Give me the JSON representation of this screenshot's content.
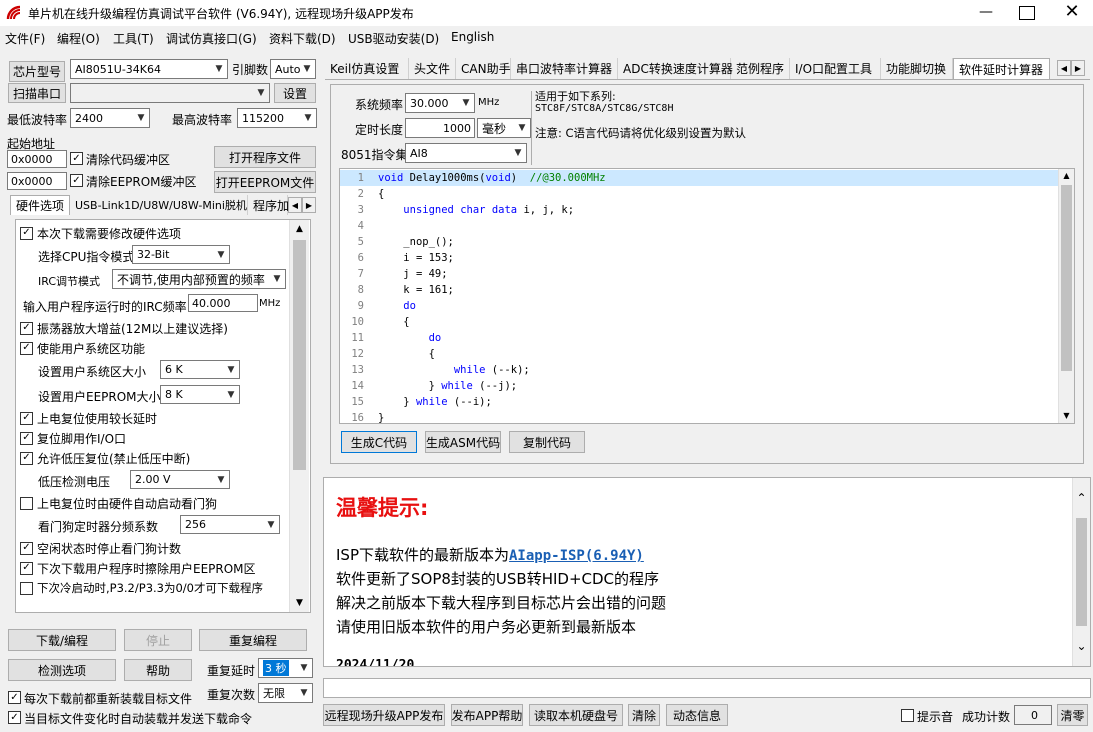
{
  "window": {
    "title": "单片机在线升级编程仿真调试平台软件 (V6.94Y), 远程现场升级APP发布"
  },
  "menu": [
    "文件(F)",
    "编程(O)",
    "工具(T)",
    "调试仿真接口(G)",
    "资料下载(D)",
    "USB驱动安装(D)",
    "English"
  ],
  "left": {
    "chip_label": "芯片型号",
    "chip_value": "AI8051U-34K64",
    "pins_label": "引脚数",
    "pins_value": "Auto",
    "scan_port": "扫描串口",
    "port_value": "",
    "settings": "设置",
    "min_baud_label": "最低波特率",
    "min_baud": "2400",
    "max_baud_label": "最高波特率",
    "max_baud": "115200",
    "start_addr_label": "起始地址",
    "addr1": "0x0000",
    "clear_code": "清除代码缓冲区",
    "open_prog": "打开程序文件",
    "addr2": "0x0000",
    "clear_eeprom": "清除EEPROM缓冲区",
    "open_eeprom": "打开EEPROM文件",
    "tabs": [
      "硬件选项",
      "USB-Link1D/U8W/U8W-Mini脱机",
      "程序加"
    ],
    "options": {
      "o1": "本次下载需要修改硬件选项",
      "cpu_label": "选择CPU指令模式",
      "cpu_value": "32-Bit",
      "irc_label": "IRC调节模式",
      "irc_value": "不调节,使用内部预置的频率",
      "freq_label": "输入用户程序运行时的IRC频率",
      "freq_value": "40.000",
      "freq_unit": "MHz",
      "o2": "振荡器放大增益(12M以上建议选择)",
      "o3": "使能用户系统区功能",
      "sys_size_label": "设置用户系统区大小",
      "sys_size": "6   K",
      "eeprom_size_label": "设置用户EEPROM大小",
      "eeprom_size": "8   K",
      "o4": "上电复位使用较长延时",
      "o5": "复位脚用作I/O口",
      "o6": "允许低压复位(禁止低压中断)",
      "lv_label": "低压检测电压",
      "lv_value": "2.00 V",
      "o7": "上电复位时由硬件自动启动看门狗",
      "wdt_label": "看门狗定时器分频系数",
      "wdt_value": "256",
      "o8": "空闲状态时停止看门狗计数",
      "o9": "下次下载用户程序时擦除用户EEPROM区",
      "o10": "下次冷启动时,P3.2/P3.3为0/0才可下载程序"
    },
    "download": "下载/编程",
    "stop": "停止",
    "reprogram": "重复编程",
    "check": "检测选项",
    "help": "帮助",
    "repeat_delay_label": "重复延时",
    "repeat_delay": "3 秒",
    "repeat_count_label": "重复次数",
    "repeat_count": "无限",
    "reload1": "每次下载前都重新装载目标文件",
    "reload2": "当目标文件变化时自动装载并发送下载命令"
  },
  "right": {
    "tabs": [
      "Keil仿真设置",
      "头文件",
      "CAN助手",
      "串口波特率计算器",
      "ADC转换速度计算器",
      "范例程序",
      "I/O口配置工具",
      "功能脚切换",
      "软件延时计算器"
    ],
    "freq_label": "系统频率",
    "freq_value": "30.000",
    "freq_unit": "MHz",
    "len_label": "定时长度",
    "len_value": "1000",
    "len_unit": "毫秒",
    "isa_label": "8051指令集",
    "isa_value": "AI8",
    "applies": "适用于如下系列:",
    "series": "STC8F/STC8A/STC8G/STC8H",
    "note": "注意: C语言代码请将优化级别设置为默认",
    "code_lines": [
      {
        "n": "1",
        "t": "void Delay1000ms(void)  //@30.000MHz"
      },
      {
        "n": "2",
        "t": "{"
      },
      {
        "n": "3",
        "t": "    unsigned char data i, j, k;"
      },
      {
        "n": "4",
        "t": ""
      },
      {
        "n": "5",
        "t": "    _nop_();"
      },
      {
        "n": "6",
        "t": "    i = 153;"
      },
      {
        "n": "7",
        "t": "    j = 49;"
      },
      {
        "n": "8",
        "t": "    k = 161;"
      },
      {
        "n": "9",
        "t": "    do"
      },
      {
        "n": "10",
        "t": "    {"
      },
      {
        "n": "11",
        "t": "        do"
      },
      {
        "n": "12",
        "t": "        {"
      },
      {
        "n": "13",
        "t": "            while (--k);"
      },
      {
        "n": "14",
        "t": "        } while (--j);"
      },
      {
        "n": "15",
        "t": "    } while (--i);"
      },
      {
        "n": "16",
        "t": "}"
      }
    ],
    "gen_c": "生成C代码",
    "gen_asm": "生成ASM代码",
    "copy_code": "复制代码",
    "notice_title": "温馨提示:",
    "notice_prefix": "ISP下载软件的最新版本为",
    "notice_link": "AIapp-ISP(6.94Y)",
    "notice_lines": [
      "软件更新了SOP8封装的USB转HID+CDC的程序",
      "解决之前版本下载大程序到目标芯片会出错的问题",
      "请使用旧版本软件的用户务必更新到最新版本"
    ],
    "notice_date": "2024/11/20",
    "bottom_buttons": [
      "远程现场升级APP发布",
      "发布APP帮助",
      "读取本机硬盘号",
      "清除",
      "动态信息"
    ],
    "beep": "提示音",
    "success_label": "成功计数",
    "success_value": "0",
    "clear_count": "清零"
  }
}
